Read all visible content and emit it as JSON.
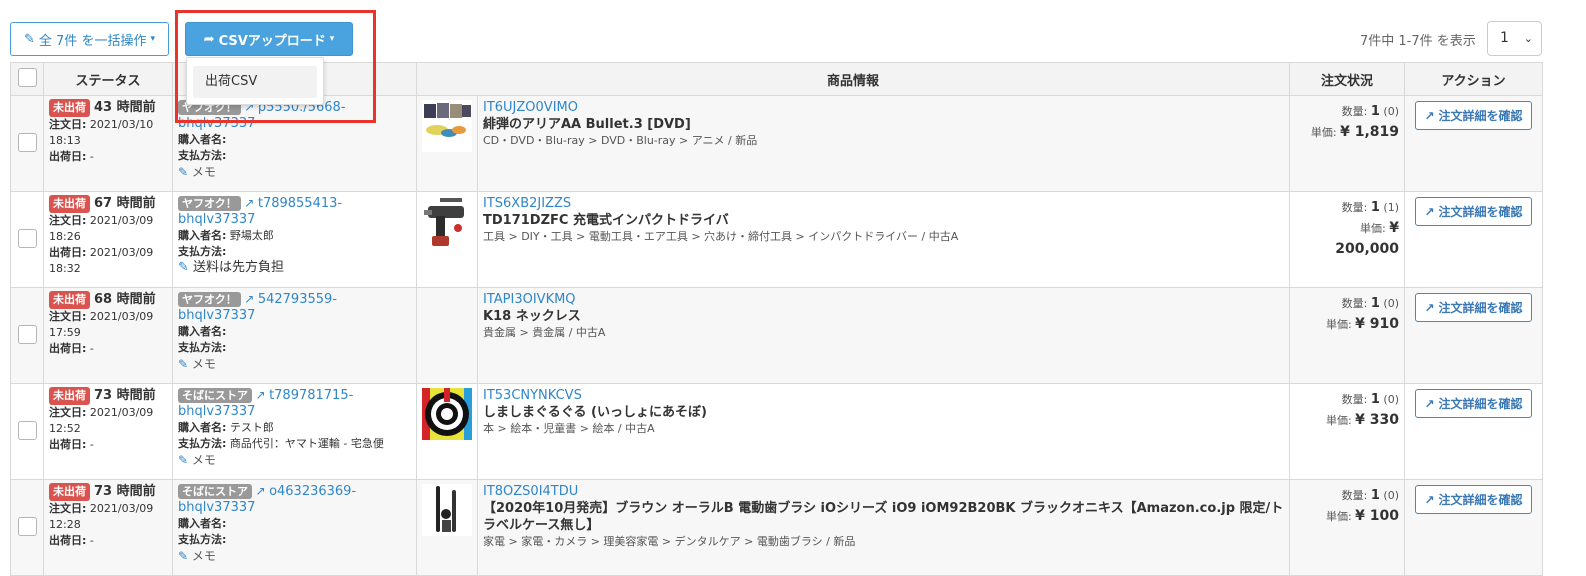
{
  "toolbar": {
    "bulk_label": "全 7件 を一括操作",
    "csv_label": "CSVアップロード",
    "dropdown_items": [
      "出荷CSV"
    ],
    "pager_info": "7件中 1-7件 を表示",
    "page_value": "1"
  },
  "table": {
    "headers": {
      "status": "ステータス",
      "product": "商品情報",
      "order_status": "注文状況",
      "action": "アクション"
    },
    "labels": {
      "order_date": "注文日:",
      "ship_date": "出荷日:",
      "buyer": "購入者名:",
      "payment": "支払方法:",
      "qty": "数量:",
      "unit": "単価:",
      "memo": "メモ",
      "detail_button": "注文詳細を確認",
      "status_badge": "未出荷"
    },
    "rows": [
      {
        "hours": "43 時間前",
        "order_date": "2021/03/10",
        "order_time": "18:13",
        "ship_date": "-",
        "ship_time": "",
        "store": "ヤフオク！",
        "order_id": "p5550./5668-",
        "account": "bhqlv37337",
        "buyer": "",
        "payment": "",
        "memo": "メモ",
        "sku": "IT6UJZO0VIMO",
        "name": "緋弾のアリアAA Bullet.3 [DVD]",
        "category": "CD・DVD・Blu-ray > DVD・Blu-ray > アニメ / 新品",
        "qty": "1",
        "qty_sub": "(0)",
        "price": "¥ 1,819"
      },
      {
        "hours": "67 時間前",
        "order_date": "2021/03/09",
        "order_time": "18:26",
        "ship_date": "2021/03/09",
        "ship_time": "18:32",
        "store": "ヤフオク！",
        "order_id": "t789855413-",
        "account": "bhqlv37337",
        "buyer": "野場太郎",
        "payment": "",
        "memo": "送料は先方負担",
        "sku": "ITS6XB2JIZZS",
        "name": "TD171DZFC 充電式インパクトドライバ",
        "category": "工具 > DIY・工具 > 電動工具・エア工具 > 穴あけ・締付工具 > インパクトドライバー / 中古A",
        "qty": "1",
        "qty_sub": "(1)",
        "price": "¥ 200,000"
      },
      {
        "hours": "68 時間前",
        "order_date": "2021/03/09",
        "order_time": "17:59",
        "ship_date": "-",
        "ship_time": "",
        "store": "ヤフオク！",
        "order_id": "542793559-",
        "account": "bhqlv37337",
        "buyer": "",
        "payment": "",
        "memo": "メモ",
        "sku": "ITAPI3OIVKMQ",
        "name": "K18 ネックレス",
        "category": "貴金属 > 貴金属 / 中古A",
        "qty": "1",
        "qty_sub": "(0)",
        "price": "¥ 910"
      },
      {
        "hours": "73 時間前",
        "order_date": "2021/03/09",
        "order_time": "12:52",
        "ship_date": "-",
        "ship_time": "",
        "store": "そばにストア",
        "order_id": "t789781715-",
        "account": "bhqlv37337",
        "buyer": "テスト郎",
        "payment": "商品代引：ヤマト運輸 - 宅急便",
        "memo": "メモ",
        "sku": "IT53CNYNKCVS",
        "name": "しましまぐるぐる (いっしょにあそぼ)",
        "category": "本 > 絵本・児童書 > 絵本 / 中古A",
        "qty": "1",
        "qty_sub": "(0)",
        "price": "¥ 330"
      },
      {
        "hours": "73 時間前",
        "order_date": "2021/03/09",
        "order_time": "12:28",
        "ship_date": "-",
        "ship_time": "",
        "store": "そばにストア",
        "order_id": "o463236369-",
        "account": "bhqlv37337",
        "buyer": "",
        "payment": "",
        "memo": "メモ",
        "sku": "IT8OZS0I4TDU",
        "name": "【2020年10月発売】ブラウン オーラルB 電動歯ブラシ iOシリーズ iO9 iOM92B20BK ブラックオニキス【Amazon.co.jp 限定/トラベルケース無し】",
        "category": "家電 > 家電・カメラ > 理美容家電 > デンタルケア > 電動歯ブラシ / 新品",
        "qty": "1",
        "qty_sub": "(0)",
        "price": "¥ 100"
      }
    ]
  },
  "colors": {
    "highlight": "#e8342a",
    "primary": "#4aa3df",
    "danger": "#d9534f",
    "link": "#2f86c8"
  },
  "icons": [
    "edit-icon",
    "share-icon",
    "caret-down-icon",
    "external-link-icon",
    "pencil-icon"
  ]
}
